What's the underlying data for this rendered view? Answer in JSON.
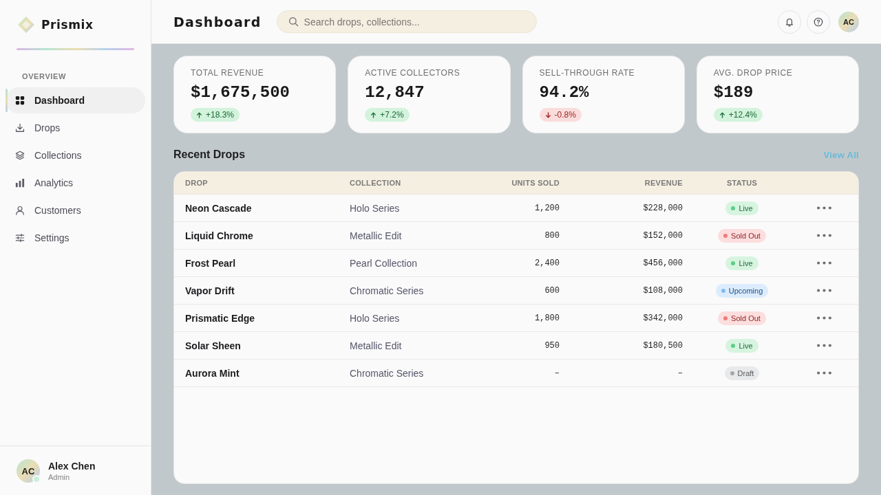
{
  "sidebar": {
    "brand": "Prismix",
    "section_label": "OVERVIEW",
    "items": [
      {
        "label": "Dashboard",
        "selected": true
      },
      {
        "label": "Drops",
        "selected": false
      },
      {
        "label": "Collections",
        "selected": false
      },
      {
        "label": "Analytics",
        "selected": false
      },
      {
        "label": "Customers",
        "selected": false
      },
      {
        "label": "Settings",
        "selected": false
      }
    ],
    "user": {
      "initials": "AC",
      "name": "Alex Chen",
      "role": "Admin",
      "online": true
    }
  },
  "header": {
    "title": "Dashboard",
    "search": {
      "placeholder": "Search drops, collections..."
    },
    "avatar_initials": "AC"
  },
  "stats": [
    {
      "label": "TOTAL REVENUE",
      "value": "$1,675,500",
      "delta": {
        "text": "+18.3%",
        "kind": "up"
      }
    },
    {
      "label": "ACTIVE COLLECTORS",
      "value": "12,847",
      "delta": {
        "text": "+7.2%",
        "kind": "up"
      }
    },
    {
      "label": "SELL-THROUGH RATE",
      "value": "94.2%",
      "delta": {
        "text": "-0.8%",
        "kind": "down"
      }
    },
    {
      "label": "AVG. DROP PRICE",
      "value": "$189",
      "delta": {
        "text": "+12.4%",
        "kind": "up"
      }
    }
  ],
  "recent_drops": {
    "title": "Recent Drops",
    "link": "View All",
    "columns": [
      "DROP",
      "COLLECTION",
      "UNITS SOLD",
      "REVENUE",
      "STATUS"
    ],
    "rows": [
      {
        "drop": "Neon Cascade",
        "collection": "Holo Series",
        "units_sold": "1,200",
        "revenue": "$228,000",
        "status": {
          "label": "Live",
          "kind": "live",
          "color": "#5ccf86"
        }
      },
      {
        "drop": "Liquid Chrome",
        "collection": "Metallic Edit",
        "units_sold": "800",
        "revenue": "$152,000",
        "status": {
          "label": "Sold Out",
          "kind": "sold_out",
          "color": "#f27a7a"
        }
      },
      {
        "drop": "Frost Pearl",
        "collection": "Pearl Collection",
        "units_sold": "2,400",
        "revenue": "$456,000",
        "status": {
          "label": "Live",
          "kind": "live",
          "color": "#5ccf86"
        }
      },
      {
        "drop": "Vapor Drift",
        "collection": "Chromatic Series",
        "units_sold": "600",
        "revenue": "$108,000",
        "status": {
          "label": "Upcoming",
          "kind": "upcoming",
          "color": "#7fbdf2"
        }
      },
      {
        "drop": "Prismatic Edge",
        "collection": "Holo Series",
        "units_sold": "1,800",
        "revenue": "$342,000",
        "status": {
          "label": "Sold Out",
          "kind": "sold_out",
          "color": "#f27a7a"
        }
      },
      {
        "drop": "Solar Sheen",
        "collection": "Metallic Edit",
        "units_sold": "950",
        "revenue": "$180,500",
        "status": {
          "label": "Live",
          "kind": "live",
          "color": "#5ccf86"
        }
      },
      {
        "drop": "Aurora Mint",
        "collection": "Chromatic Series",
        "units_sold": "–",
        "revenue": "–",
        "status": {
          "label": "Draft",
          "kind": "draft",
          "color": "#a5a5a5"
        }
      }
    ]
  }
}
